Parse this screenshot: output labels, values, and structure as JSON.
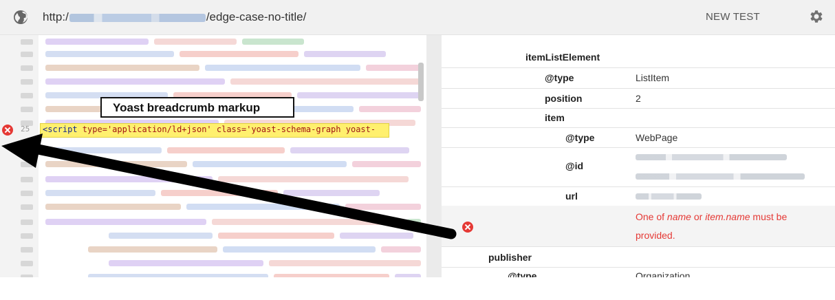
{
  "browser": {
    "url_prefix": "http:/",
    "url_suffix": "/edge-case-no-title/",
    "new_test_label": "NEW TEST",
    "globe_icon": "globe-icon",
    "settings_icon": "gear-icon"
  },
  "code": {
    "line_number": "25",
    "line_text_open": "<script",
    "line_text_attr1": " type=",
    "line_text_val1": "'application/ld+json'",
    "line_text_attr2": " class=",
    "line_text_val2": "'yoast-schema-graph",
    "line_text_rest": " yoast-",
    "highlight_color": "#fff06e",
    "error_icon": "error-icon"
  },
  "annotation": {
    "callout_text": "Yoast breadcrumb markup",
    "arrow_color": "#000000"
  },
  "structured_data": {
    "rows": [
      {
        "key": "itemListElement",
        "value": ""
      },
      {
        "key": "@type",
        "value": "ListItem"
      },
      {
        "key": "position",
        "value": "2"
      },
      {
        "key": "item",
        "value": ""
      },
      {
        "key": "@type",
        "value": "WebPage"
      },
      {
        "key": "@id",
        "value": ""
      },
      {
        "key": "url",
        "value": ""
      },
      {
        "key": "publisher",
        "value": ""
      },
      {
        "key": "@type",
        "value": "Organization"
      }
    ],
    "error": {
      "prefix": "One of ",
      "term1": "name",
      "middle": " or ",
      "term2": "item.name",
      "suffix": " must be provided.",
      "color": "#e53935"
    }
  }
}
